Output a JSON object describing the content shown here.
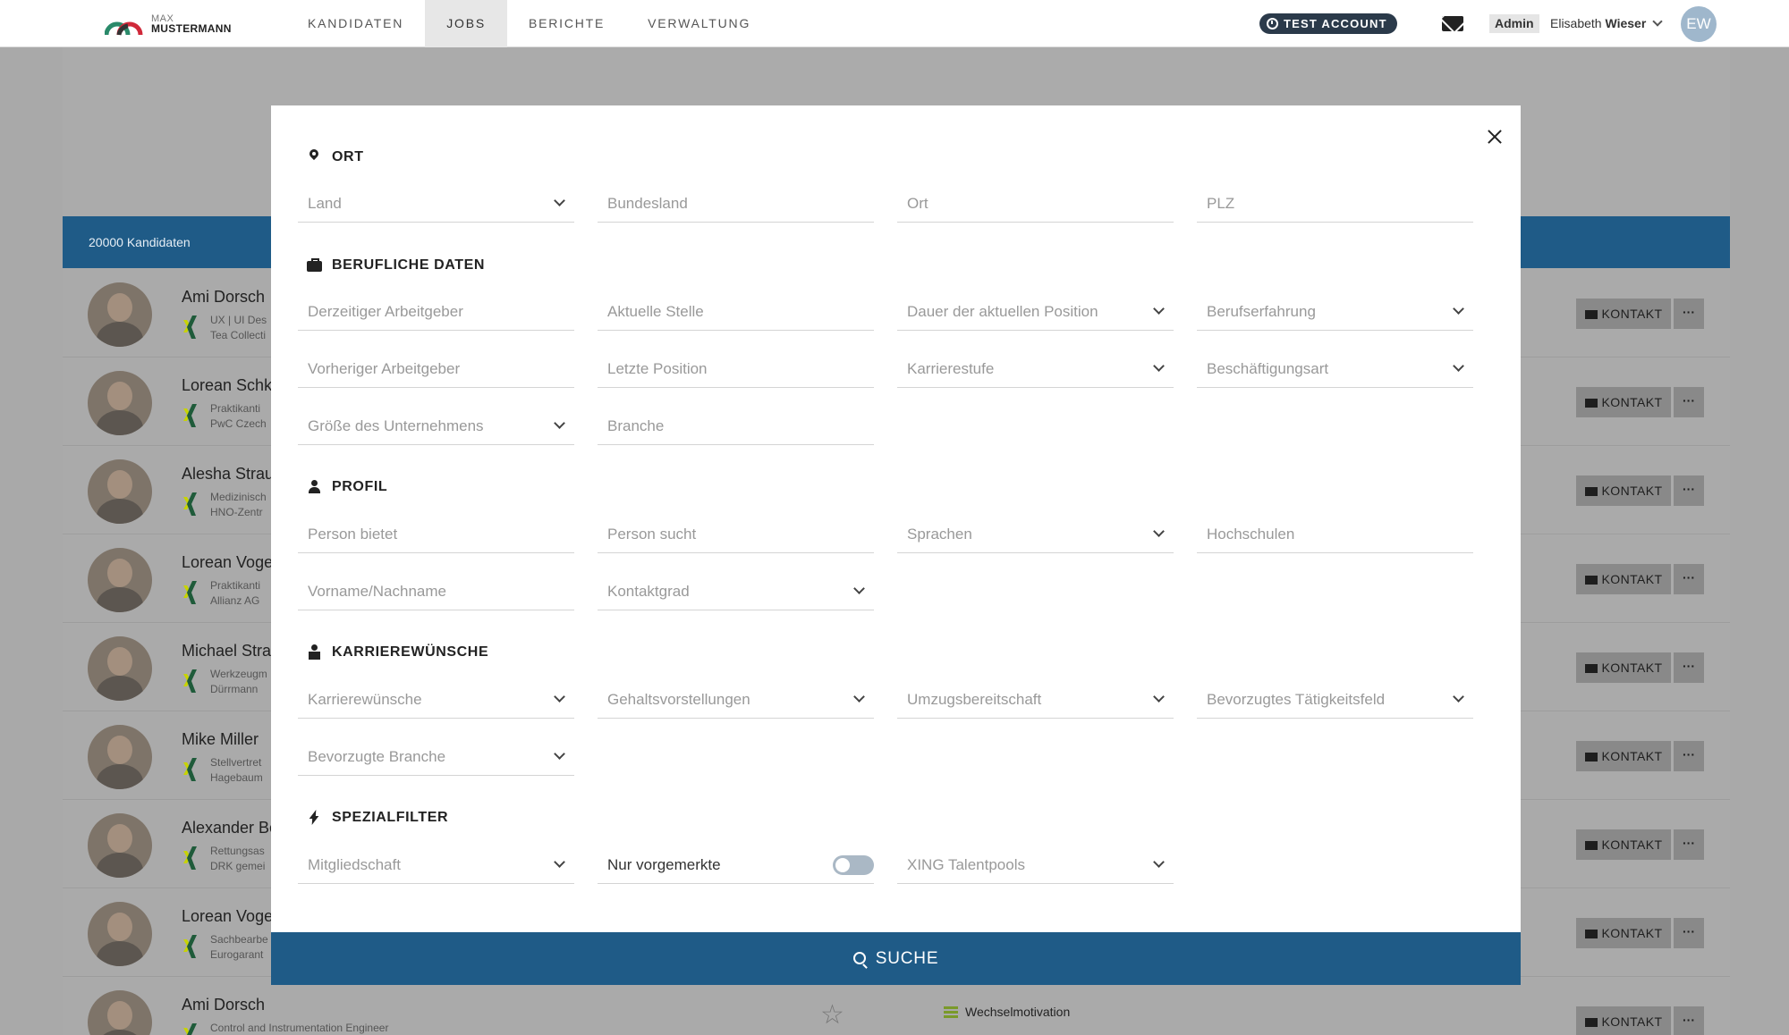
{
  "brand": {
    "line1": "MAX",
    "line2": "MUSTERMANN"
  },
  "nav": [
    {
      "label": "KANDIDATEN",
      "active": false
    },
    {
      "label": "JOBS",
      "active": true
    },
    {
      "label": "BERICHTE",
      "active": false
    },
    {
      "label": "VERWALTUNG",
      "active": false
    }
  ],
  "header": {
    "test_account": "TEST ACCOUNT",
    "role": "Admin",
    "user_first": "Elisabeth",
    "user_last": "Wieser",
    "initials": "EW"
  },
  "list": {
    "count_label": "20000 Kandidaten",
    "kontakt_label": "KONTAKT",
    "more_label": "···",
    "rows": [
      {
        "name": "Ami Dorsch",
        "line1": "UX | UI Des",
        "line2": "Tea Collecti"
      },
      {
        "name": "Lorean Schk",
        "line1": "Praktikanti",
        "line2": "PwC Czech"
      },
      {
        "name": "Alesha Strau",
        "line1": "Medizinisch",
        "line2": "HNO-Zentr"
      },
      {
        "name": "Lorean Voge",
        "line1": "Praktikanti",
        "line2": "Allianz AG"
      },
      {
        "name": "Michael Strau",
        "line1": "Werkzeugm",
        "line2": "Dürrmann"
      },
      {
        "name": "Mike Miller",
        "line1": "Stellvertret",
        "line2": "Hagebaum"
      },
      {
        "name": "Alexander Be",
        "line1": "Rettungsas",
        "line2": "DRK gemei"
      },
      {
        "name": "Lorean Voge",
        "line1": "Sachbearbe",
        "line2": "Eurogarant"
      },
      {
        "name": "Ami Dorsch",
        "line1": "Control and Instrumentation Engineer",
        "line2": ""
      }
    ],
    "last_row_status": "Wechselmotivation"
  },
  "modal": {
    "sections": {
      "ort": "ORT",
      "beruf": "BERUFLICHE DATEN",
      "profil": "PROFIL",
      "karriere": "KARRIEREWÜNSCHE",
      "spezial": "SPEZIALFILTER"
    },
    "fields": {
      "land": "Land",
      "bundesland": "Bundesland",
      "ort": "Ort",
      "plz": "PLZ",
      "derzeitiger_arbeitgeber": "Derzeitiger Arbeitgeber",
      "aktuelle_stelle": "Aktuelle Stelle",
      "dauer_position": "Dauer der aktuellen Position",
      "berufserfahrung": "Berufserfahrung",
      "vorheriger_arbeitgeber": "Vorheriger Arbeitgeber",
      "letzte_position": "Letzte Position",
      "karrierestufe": "Karrierestufe",
      "beschaeftigungsart": "Beschäftigungsart",
      "groesse_unternehmen": "Größe des Unternehmens",
      "branche": "Branche",
      "person_bietet": "Person bietet",
      "person_sucht": "Person sucht",
      "sprachen": "Sprachen",
      "hochschulen": "Hochschulen",
      "name": "Vorname/Nachname",
      "kontaktgrad": "Kontaktgrad",
      "karrierewuensche": "Karrierewünsche",
      "gehalt": "Gehaltsvorstellungen",
      "umzug": "Umzugsbereitschaft",
      "taetigkeitsfeld": "Bevorzugtes Tätigkeitsfeld",
      "bev_branche": "Bevorzugte Branche",
      "mitgliedschaft": "Mitgliedschaft",
      "nur_vorgemerkte": "Nur vorgemerkte",
      "xing_talentpools": "XING Talentpools"
    },
    "nur_vorgemerkte_on": false,
    "search_label": "SUCHE"
  },
  "colors": {
    "primary": "#1f5b87",
    "xing": "#c8d400"
  }
}
